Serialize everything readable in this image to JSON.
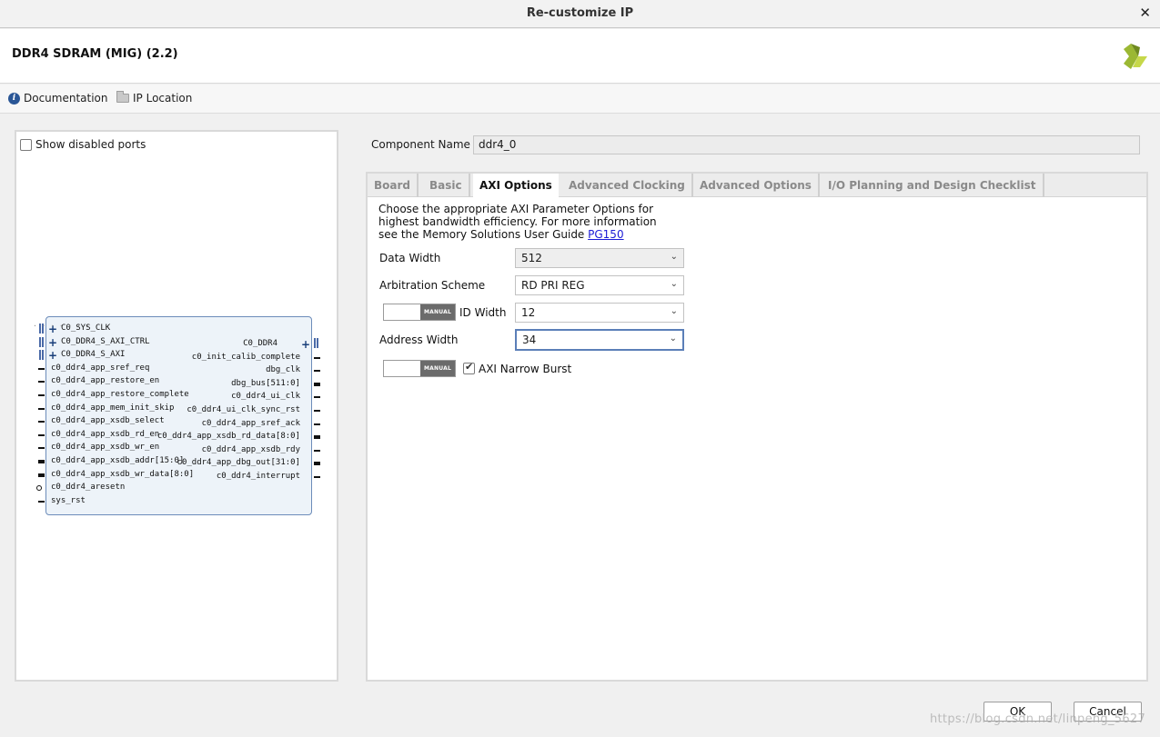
{
  "window": {
    "title": "Re-customize IP",
    "close_glyph": "✕"
  },
  "header": {
    "ip_title": "DDR4 SDRAM (MIG) (2.2)",
    "logo_icon": "xilinx-logo-icon"
  },
  "links": {
    "documentation": "Documentation",
    "ip_location": "IP Location"
  },
  "left_panel": {
    "show_disabled_ports_label": "Show disabled ports",
    "show_disabled_ports_checked": false,
    "left_bus_pins": [
      "C0_SYS_CLK",
      "C0_DDR4_S_AXI_CTRL",
      "C0_DDR4_S_AXI"
    ],
    "left_pins": [
      "c0_ddr4_app_sref_req",
      "c0_ddr4_app_restore_en",
      "c0_ddr4_app_restore_complete",
      "c0_ddr4_app_mem_init_skip",
      "c0_ddr4_app_xsdb_select",
      "c0_ddr4_app_xsdb_rd_en",
      "c0_ddr4_app_xsdb_wr_en",
      "c0_ddr4_app_xsdb_addr[15:0]",
      "c0_ddr4_app_xsdb_wr_data[8:0]",
      "c0_ddr4_aresetn",
      "sys_rst"
    ],
    "right_bus_pin": "C0_DDR4",
    "right_pins": [
      "c0_init_calib_complete",
      "dbg_clk",
      "dbg_bus[511:0]",
      "c0_ddr4_ui_clk",
      "c0_ddr4_ui_clk_sync_rst",
      "c0_ddr4_app_sref_ack",
      "c0_ddr4_app_xsdb_rd_data[8:0]",
      "c0_ddr4_app_xsdb_rdy",
      "c0_ddr4_app_dbg_out[31:0]",
      "c0_ddr4_interrupt"
    ]
  },
  "component": {
    "label": "Component Name",
    "value": "ddr4_0"
  },
  "tabs": [
    "Board",
    "Basic",
    "AXI Options",
    "Advanced Clocking",
    "Advanced Options",
    "I/O Planning and Design Checklist"
  ],
  "active_tab": "AXI Options",
  "axi": {
    "description_1": "Choose the appropriate AXI Parameter Options for",
    "description_2": "highest bandwidth efficiency. For more information",
    "description_3": "see the Memory Solutions User Guide ",
    "guide_link": "PG150",
    "data_width_label": "Data Width",
    "data_width": "512",
    "arbitration_label": "Arbitration Scheme",
    "arbitration": "RD PRI REG",
    "id_width_label": "ID Width",
    "id_width": "12",
    "address_width_label": "Address Width",
    "address_width": "34",
    "manual_label": "MANUAL",
    "narrow_burst_label": "AXI Narrow Burst",
    "narrow_burst_checked": true
  },
  "footer": {
    "ok": "OK",
    "cancel": "Cancel",
    "watermark": "https://blog.csdn.net/linpeng_5627"
  }
}
